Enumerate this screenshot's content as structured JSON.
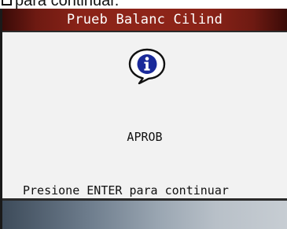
{
  "document": {
    "caption_fragment": "para continuar.",
    "enter_key_icon": "enter-key-icon"
  },
  "screen": {
    "title": "Prueb Balanc Cilind",
    "icon": "info-speech-bubble-icon",
    "status": "APROB",
    "prompt": "Presione ENTER para continuar"
  },
  "colors": {
    "title_bar": "#8e2419",
    "title_text": "#ffffff",
    "content_bg": "#f2f2f2",
    "icon_fill": "#1a2a9a"
  }
}
